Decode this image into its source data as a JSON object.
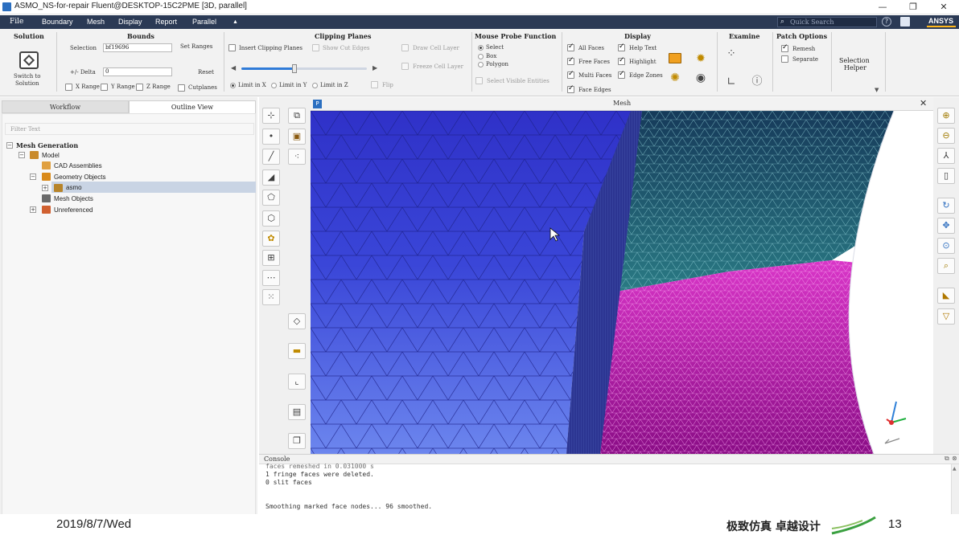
{
  "title": "ASMO_NS-for-repair Fluent@DESKTOP-15C2PME  [3D, parallel]",
  "window_buttons": {
    "minimize": "—",
    "restore": "❐",
    "close": "✕"
  },
  "menu": [
    "File",
    "Boundary",
    "Mesh",
    "Display",
    "Report",
    "Parallel"
  ],
  "menu_more": "▲",
  "quick_search_placeholder": "Quick Search",
  "brand": "ANSYS",
  "ribbon": {
    "solution": {
      "title": "Solution",
      "switch_label_1": "Switch to",
      "switch_label_2": "Solution"
    },
    "bounds": {
      "title": "Bounds",
      "selection_label": "Selection",
      "selection_value": "bf19696",
      "set_ranges": "Set Ranges",
      "delta_label": "+/- Delta",
      "delta_value": "0",
      "reset": "Reset",
      "x_range": "X Range",
      "y_range": "Y Range",
      "z_range": "Z Range",
      "cutplanes": "Cutplanes"
    },
    "clipping": {
      "title": "Clipping Planes",
      "insert": "Insert Clipping Planes",
      "show_cut_edges": "Show Cut Edges",
      "draw_cell_layer": "Draw Cell Layer",
      "freeze_cell_layer": "Freeze Cell Layer",
      "slider_value": 0.42,
      "limit_x": "Limit in X",
      "limit_y": "Limit in Y",
      "limit_z": "Limit in Z",
      "flip": "Flip"
    },
    "probe": {
      "title": "Mouse Probe Function",
      "select": "Select",
      "box": "Box",
      "polygon": "Polygon",
      "visible": "Select Visible Entities"
    },
    "display": {
      "title": "Display",
      "all_faces": "All Faces",
      "free_faces": "Free Faces",
      "multi_faces": "Multi Faces",
      "face_edges": "Face Edges",
      "help_text": "Help Text",
      "highlight": "Highlight",
      "edge_zones": "Edge Zones"
    },
    "examine": {
      "title": "Examine"
    },
    "patch": {
      "title": "Patch Options",
      "remesh": "Remesh",
      "separate": "Separate"
    },
    "selection_helper": {
      "line1": "Selection",
      "line2": "Helper"
    }
  },
  "left": {
    "tabs": [
      "Workflow",
      "Outline View"
    ],
    "filter_placeholder": "Filter Text",
    "tree": [
      "Mesh Generation",
      "Model",
      "CAD Assemblies",
      "Geometry Objects",
      "asmo",
      "Mesh Objects",
      "Unreferenced"
    ]
  },
  "viewport": {
    "badge": "P",
    "title": "Mesh",
    "close": "✕"
  },
  "console": {
    "title": "Console",
    "lines": [
      "faces remeshed in 0.031000 s",
      "1 fringe faces were deleted.",
      "0 slit faces",
      "",
      "Smoothing marked face nodes... 96 smoothed."
    ]
  },
  "footer": {
    "date": "2019/8/7/Wed",
    "slogan": "极致仿真 卓越设计",
    "page": "13"
  },
  "colors": {
    "menubar": "#2b3a55",
    "accent": "#ffb71b",
    "mesh_blue": "#3a4ee0",
    "mesh_magenta": "#b31aa0",
    "mesh_teal": "#1f5e6e"
  }
}
